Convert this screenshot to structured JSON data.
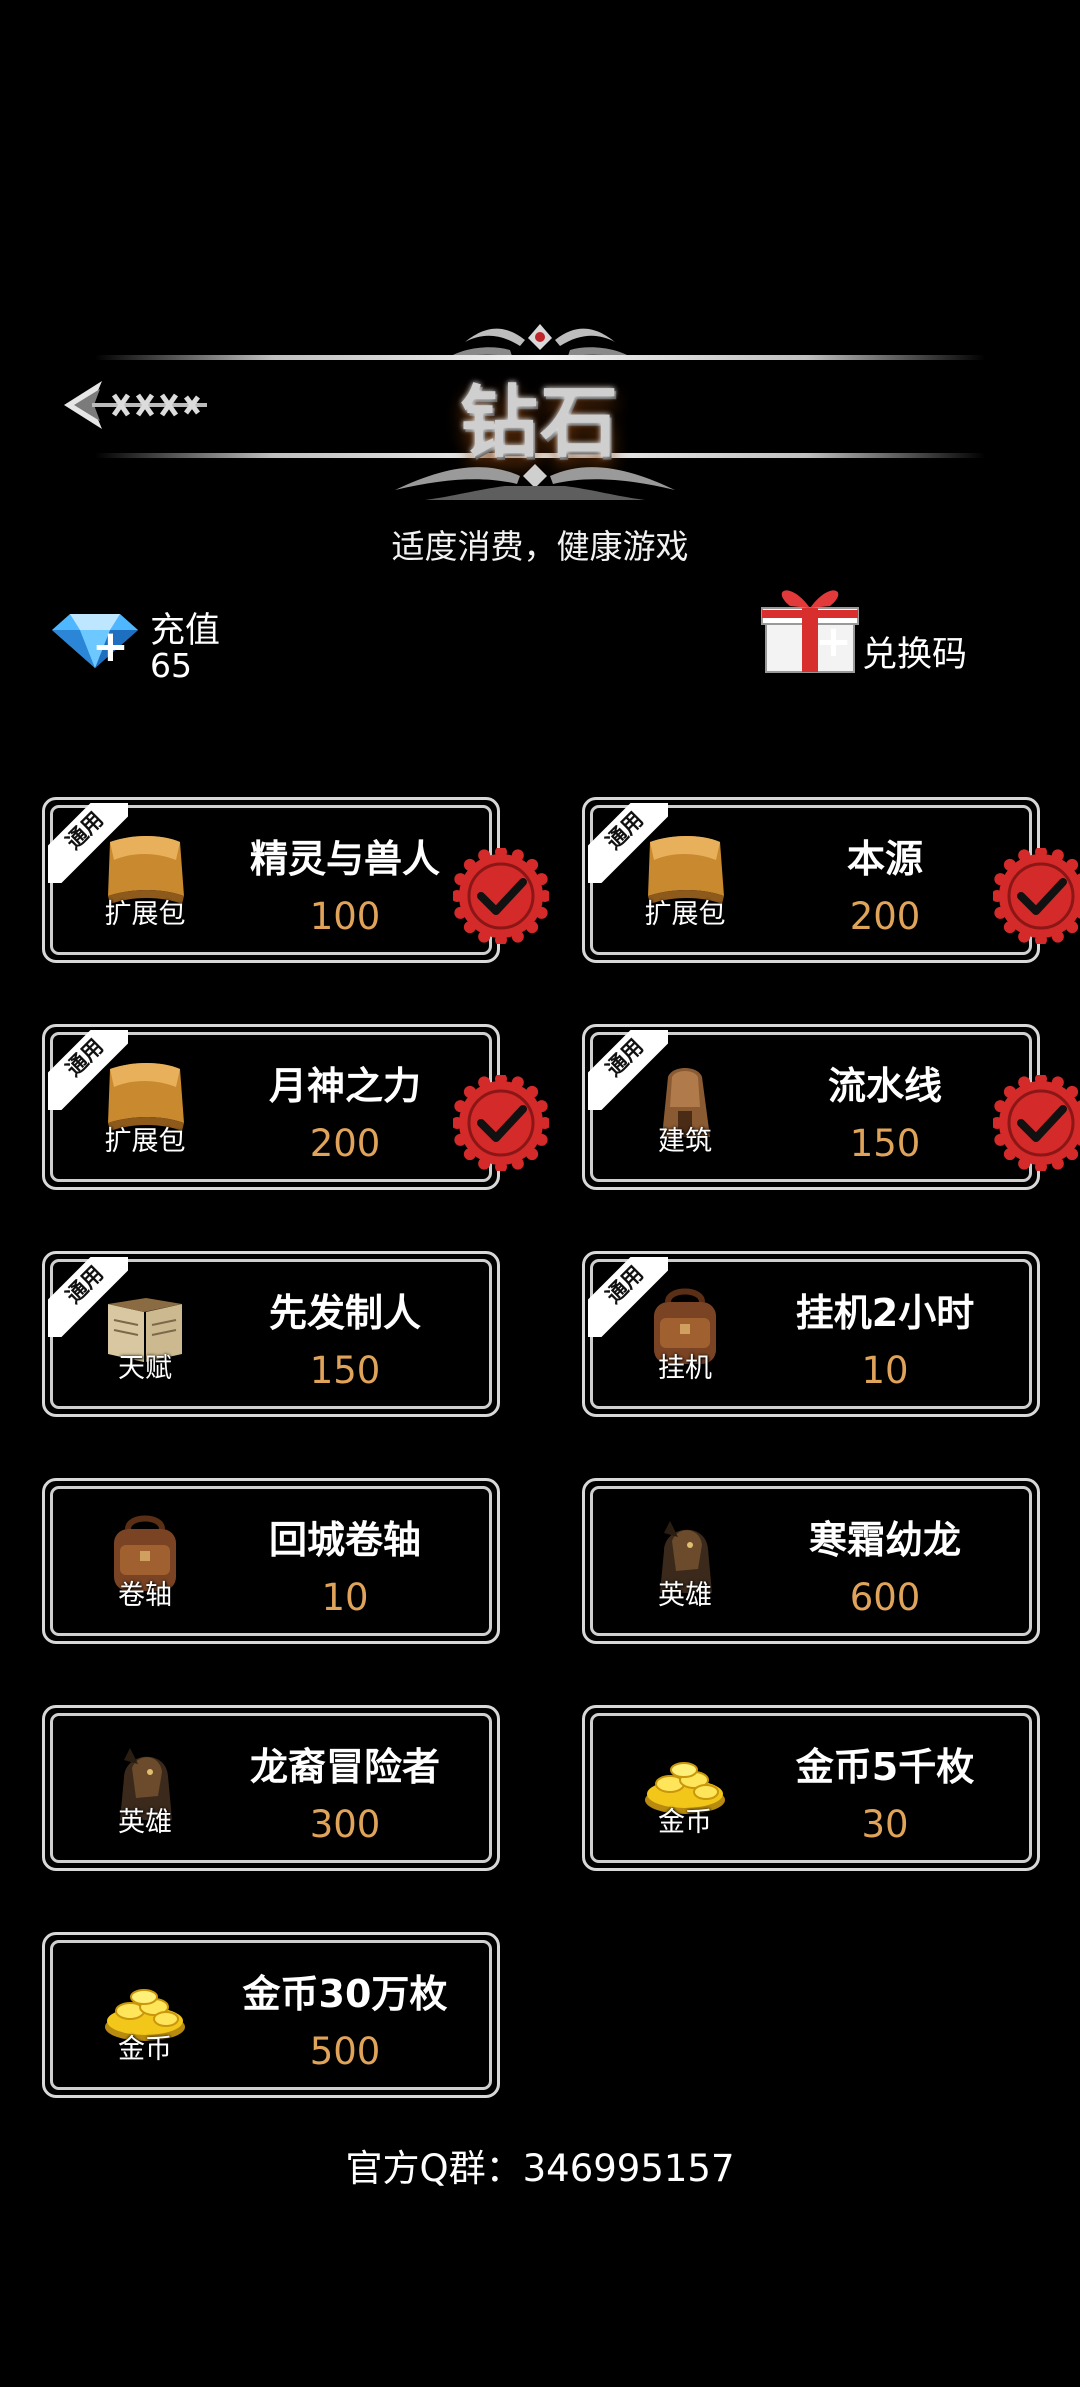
{
  "header": {
    "title": "钻石",
    "subtitle": "适度消费，健康游戏"
  },
  "recharge": {
    "label": "充值",
    "value": "65",
    "icon": "diamond-icon"
  },
  "redeem": {
    "label": "兑换码",
    "icon": "gift-icon"
  },
  "badge_text": "通用",
  "items": [
    {
      "name": "精灵与兽人",
      "price": "100",
      "icon_label": "扩展包",
      "icon": "scroll-icon",
      "badge": true,
      "checked": true
    },
    {
      "name": "本源",
      "price": "200",
      "icon_label": "扩展包",
      "icon": "scroll-icon",
      "badge": true,
      "checked": true
    },
    {
      "name": "月神之力",
      "price": "200",
      "icon_label": "扩展包",
      "icon": "scroll-icon",
      "badge": true,
      "checked": true
    },
    {
      "name": "流水线",
      "price": "150",
      "icon_label": "建筑",
      "icon": "building-icon",
      "badge": true,
      "checked": true
    },
    {
      "name": "先发制人",
      "price": "150",
      "icon_label": "天赋",
      "icon": "book-icon",
      "badge": true,
      "checked": false
    },
    {
      "name": "挂机2小时",
      "price": "10",
      "icon_label": "挂机",
      "icon": "backpack-icon",
      "badge": true,
      "checked": false
    },
    {
      "name": "回城卷轴",
      "price": "10",
      "icon_label": "卷轴",
      "icon": "backpack-icon",
      "badge": false,
      "checked": false
    },
    {
      "name": "寒霜幼龙",
      "price": "600",
      "icon_label": "英雄",
      "icon": "hero-icon",
      "badge": false,
      "checked": false
    },
    {
      "name": "龙裔冒险者",
      "price": "300",
      "icon_label": "英雄",
      "icon": "hero-icon",
      "badge": false,
      "checked": false
    },
    {
      "name": "金币5千枚",
      "price": "30",
      "icon_label": "金币",
      "icon": "coins-icon",
      "badge": false,
      "checked": false
    },
    {
      "name": "金币30万枚",
      "price": "500",
      "icon_label": "金币",
      "icon": "coins-icon",
      "badge": false,
      "checked": false
    }
  ],
  "footer": {
    "text": "官方Q群：346995157"
  },
  "colors": {
    "price": "#e0a35a",
    "check_red": "#d42a2a",
    "background": "#000000"
  }
}
